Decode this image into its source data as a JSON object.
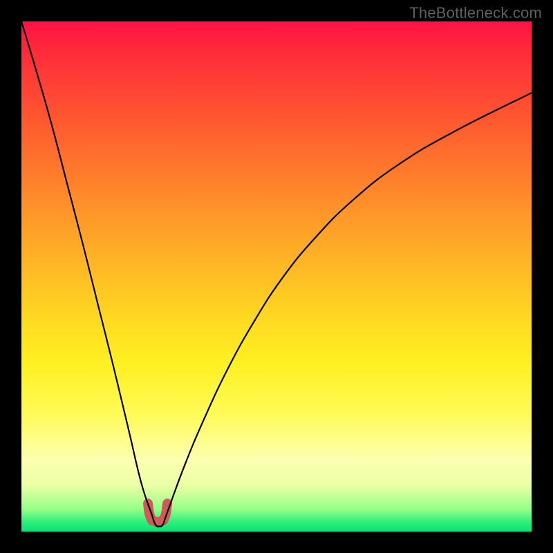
{
  "watermark": "TheBottleneck.com",
  "gradient": {
    "top": "#ff1244",
    "mid1": "#ff8a2a",
    "mid2": "#fff022",
    "bottom": "#00e477"
  },
  "chart_data": {
    "type": "line",
    "title": "",
    "xlabel": "",
    "ylabel": "",
    "xlim": [
      0,
      1
    ],
    "ylim": [
      0,
      1
    ],
    "note": "Axes are unlabeled; x and y run 0..1 across the inner plot. y is inverted visually (0 at top, 1 at bottom). Curve is a V-shaped function with minimum near x≈0.265 reaching y≈1 (bottom edge).",
    "series": [
      {
        "name": "left-branch",
        "x": [
          0.0,
          0.03,
          0.06,
          0.09,
          0.12,
          0.15,
          0.18,
          0.21,
          0.235,
          0.255
        ],
        "y": [
          0.0,
          0.1,
          0.205,
          0.32,
          0.435,
          0.555,
          0.675,
          0.8,
          0.905,
          0.965
        ]
      },
      {
        "name": "valley",
        "x": [
          0.255,
          0.262,
          0.27,
          0.278,
          0.285
        ],
        "y": [
          0.965,
          0.985,
          0.99,
          0.985,
          0.965
        ]
      },
      {
        "name": "right-branch",
        "x": [
          0.285,
          0.32,
          0.36,
          0.405,
          0.455,
          0.51,
          0.575,
          0.65,
          0.74,
          0.85,
          1.0
        ],
        "y": [
          0.965,
          0.87,
          0.775,
          0.68,
          0.59,
          0.505,
          0.425,
          0.35,
          0.28,
          0.215,
          0.14
        ]
      }
    ],
    "marker": {
      "name": "u-marker",
      "color": "#cf5a5a",
      "stroke_width": 14,
      "x": [
        0.248,
        0.253,
        0.262,
        0.272,
        0.281,
        0.286
      ],
      "y": [
        0.945,
        0.972,
        0.98,
        0.98,
        0.972,
        0.945
      ]
    }
  }
}
